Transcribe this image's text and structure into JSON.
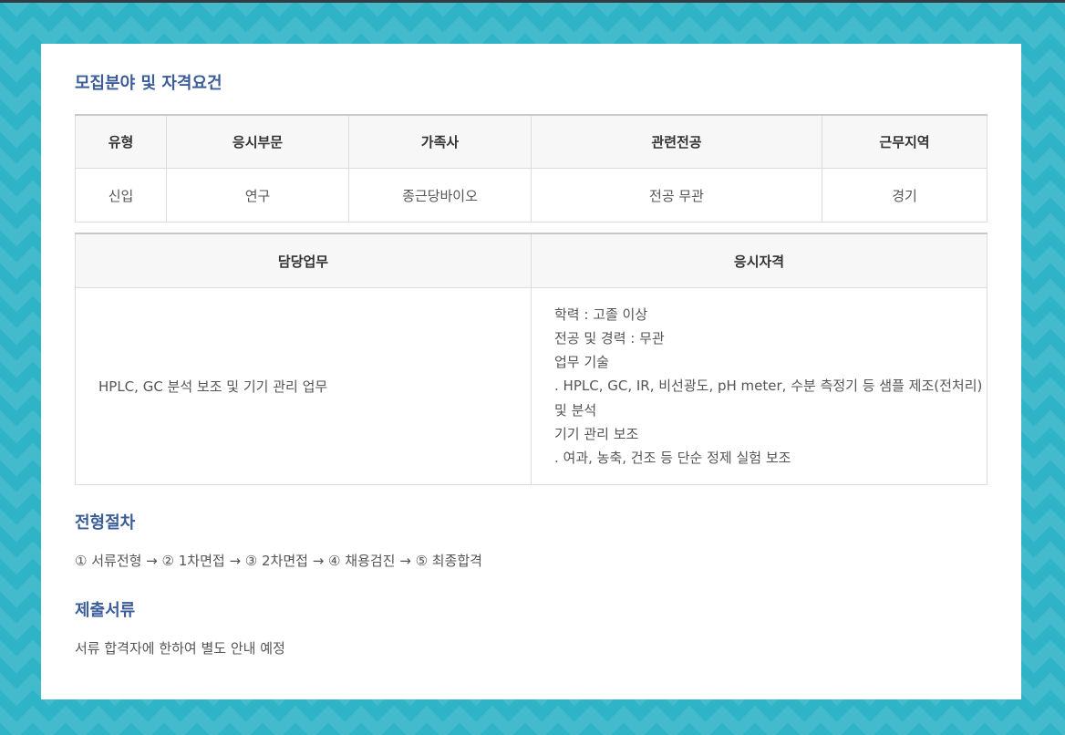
{
  "sections": {
    "recruit_title": "모집분야 및 자격요건",
    "process_title": "전형절차",
    "documents_title": "제출서류"
  },
  "table1": {
    "headers": [
      "유형",
      "응시부문",
      "가족사",
      "관련전공",
      "근무지역"
    ],
    "row": [
      "신입",
      "연구",
      "종근당바이오",
      "전공 무관",
      "경기"
    ]
  },
  "table2": {
    "headers": [
      "담당업무",
      "응시자격"
    ],
    "duty": "HPLC, GC 분석 보조 및 기기 관리 업무",
    "qualifications": [
      "학력 : 고졸 이상",
      "전공 및 경력 : 무관",
      "업무 기술",
      ". HPLC, GC, IR, 비선광도, pH meter, 수분 측정기 등 샘플 제조(전처리) 및 분석",
      "기기 관리 보조",
      ". 여과, 농축, 건조 등 단순 정제 실험 보조"
    ]
  },
  "process_text": "① 서류전형 → ② 1차면접 → ③ 2차면접 → ④ 채용검진 → ⑤ 최종합격",
  "documents_text": "서류 합격자에 한하여 별도 안내 예정",
  "colors": {
    "background": "#2fb3c7",
    "title": "#3a5d9a",
    "header_bg": "#f7f7f7"
  }
}
